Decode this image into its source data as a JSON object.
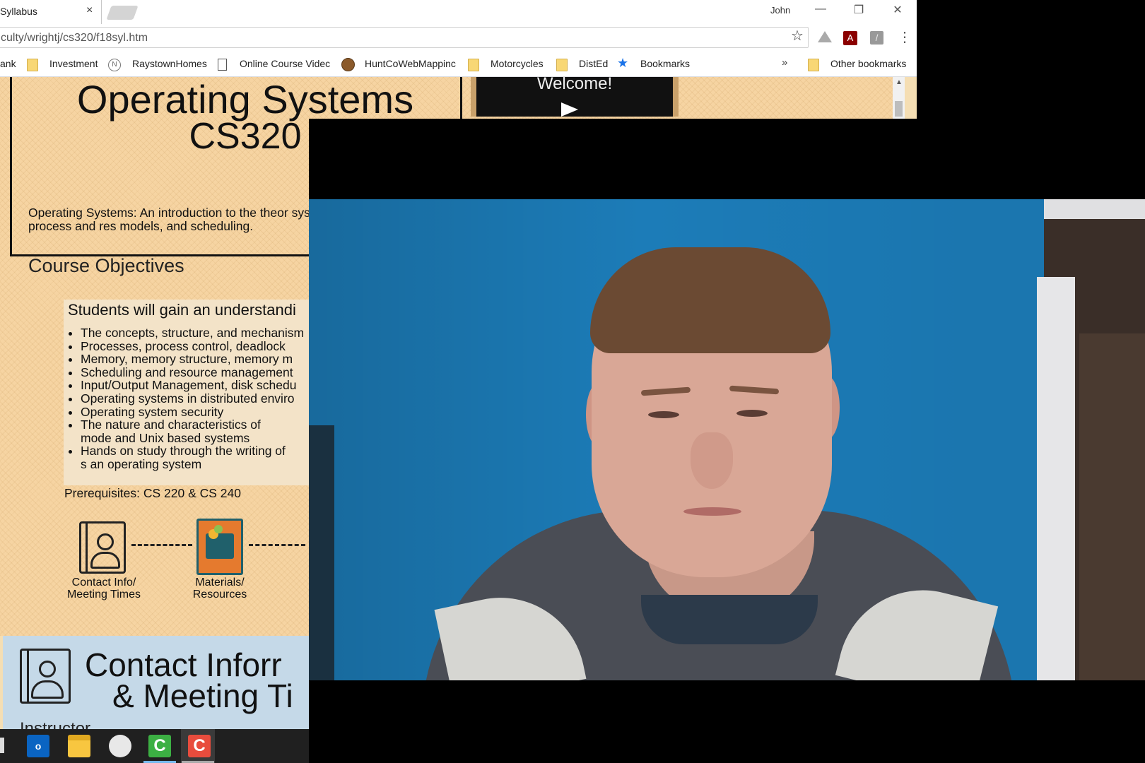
{
  "tab": {
    "title": "Syllabus",
    "close": "×"
  },
  "window": {
    "profile_name": "John",
    "minimize": "—",
    "maximize": "❐",
    "close": "✕"
  },
  "address_bar": {
    "url": "culty/wrightj/cs320/f18syl.htm"
  },
  "bookmarks": {
    "items": [
      "ank",
      "Investment",
      "RaystownHomes",
      "Online Course Videc",
      "HuntCoWebMappinc",
      "Motorcycles",
      "DistEd",
      "Bookmarks"
    ],
    "more": "»",
    "other": "Other bookmarks"
  },
  "page": {
    "title_line1": "Operating Systems",
    "title_line2": "CS320",
    "video_label": "Welcome!",
    "description": "Operating Systems:  An introduction to the theor systems. Topics include memory, process and res models, and scheduling.",
    "objectives_heading": "Course Objectives",
    "objectives_subheading": "Students will gain an understandi",
    "objectives": [
      "The concepts, structure, and mechanism",
      "Processes, process control, deadlock",
      "Memory, memory structure, memory m",
      "Scheduling and resource management",
      "Input/Output Management, disk schedu",
      "Operating systems in distributed enviro",
      "Operating system security",
      "The nature and characteristics of mode and Unix based systems",
      "Hands on study through the writing of s an operating system"
    ],
    "prerequisites": "Prerequisites: CS 220 & CS 240",
    "nav_contact": "Contact Info/ Meeting Times",
    "nav_materials": "Materials/ Resources",
    "contact_title_1": "Contact Inforr",
    "contact_title_2": "& Meeting Ti",
    "instructor": "Instructor"
  },
  "taskbar": {
    "outlook_label": "o"
  },
  "colors": {
    "page_bg": "#f6d4a2",
    "contact_bg": "#c5d9e8",
    "wall": "#1c7cb8"
  }
}
